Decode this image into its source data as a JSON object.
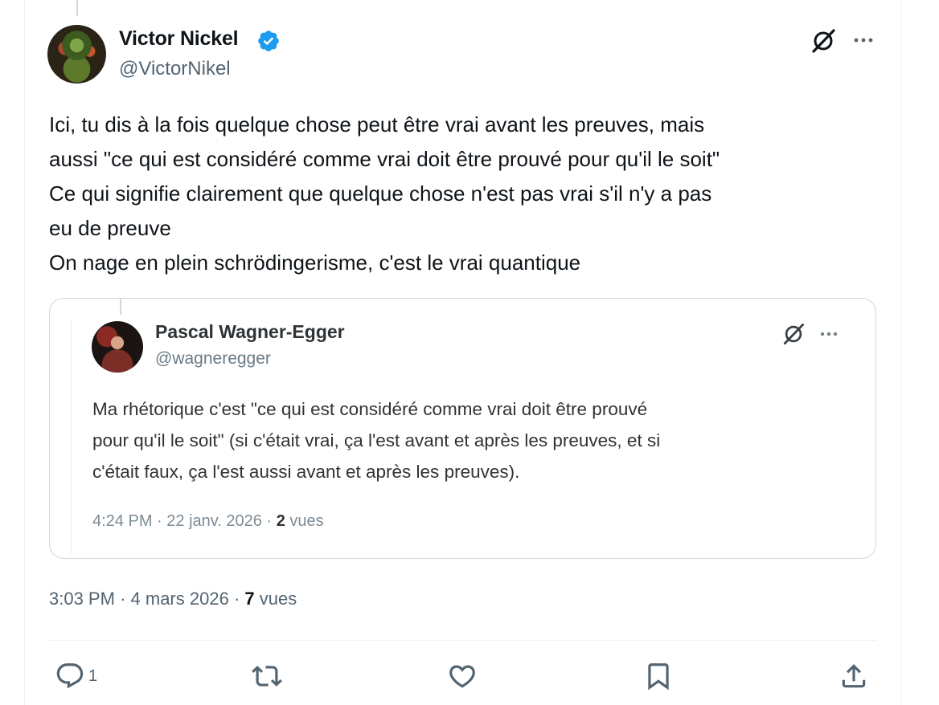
{
  "tweet": {
    "author": {
      "name": "Victor Nickel",
      "handle": "@VictorNikel",
      "verified": true
    },
    "text_lines": [
      "Ici, tu dis à la fois quelque chose peut être vrai avant les preuves, mais",
      "aussi \"ce qui est considéré comme vrai doit être prouvé pour qu'il le soit\"",
      "Ce qui signifie clairement que quelque chose n'est pas vrai s'il n'y a pas",
      "eu de preuve",
      "On nage en plein schrödingerisme, c'est le vrai quantique"
    ],
    "meta": {
      "time": "3:03 PM",
      "separator": "·",
      "date": "4 mars 2026",
      "views_count": "7",
      "views_label": "vues"
    }
  },
  "quote": {
    "author": {
      "name": "Pascal Wagner-Egger",
      "handle": "@wagneregger"
    },
    "text_lines": [
      "Ma rhétorique c'est \"ce qui est considéré comme vrai doit être prouvé",
      "pour qu'il le soit\" (si c'était vrai, ça l'est avant et après les preuves, et si",
      "c'était faux, ça l'est aussi avant et après les preuves)."
    ],
    "meta": {
      "time": "4:24 PM",
      "separator": "·",
      "date": "22 janv. 2026",
      "views_count": "2",
      "views_label": "vues"
    }
  },
  "actions": {
    "reply_count": "1",
    "retweet_count": "",
    "like_count": "",
    "icons": [
      "reply-icon",
      "retweet-icon",
      "like-icon",
      "bookmark-icon",
      "share-icon"
    ]
  },
  "colors": {
    "text_primary": "#0f1419",
    "text_secondary": "#536471",
    "verified_blue": "#1d9bf0",
    "border": "#cfd9de"
  }
}
